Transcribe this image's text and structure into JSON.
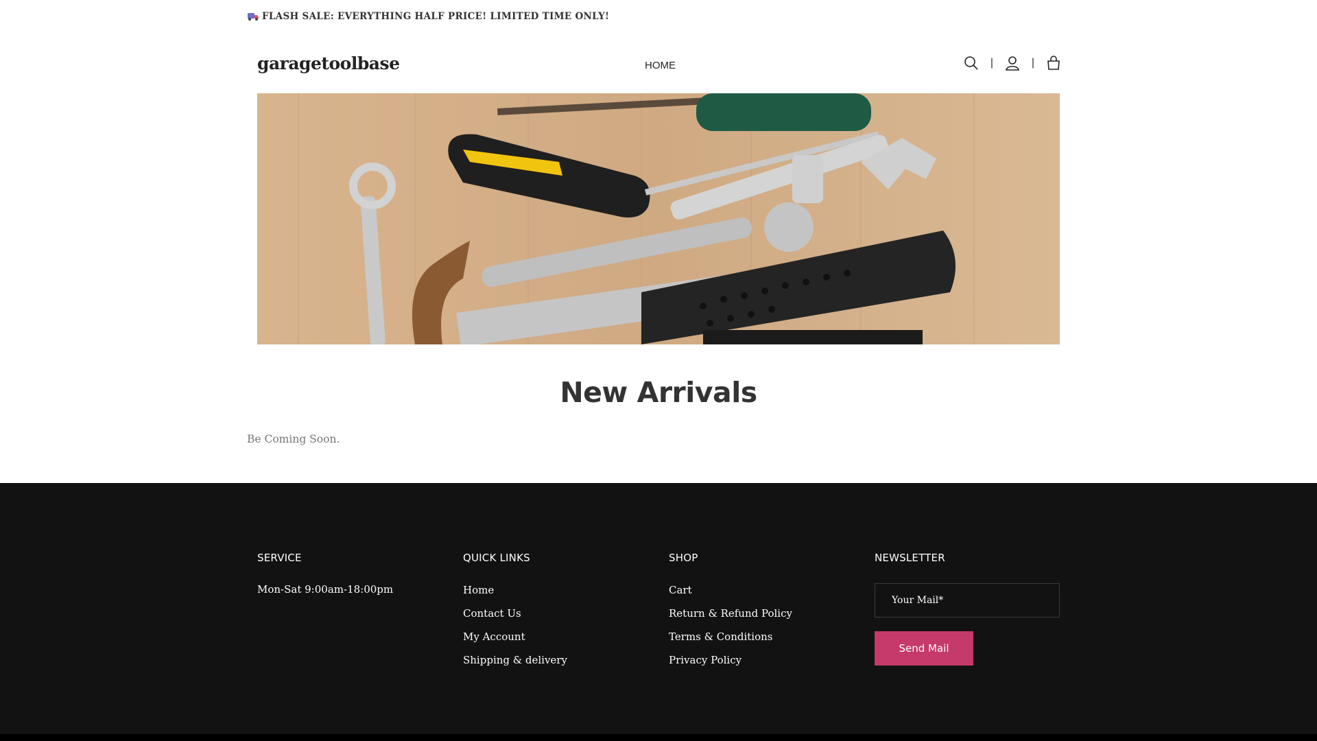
{
  "announcement": {
    "text": "FLASH SALE: EVERYTHING HALF PRICE! LIMITED TIME ONLY!",
    "icon": "truck-icon"
  },
  "header": {
    "logo": "garagetoolbase",
    "nav": [
      "HOME"
    ],
    "icons": [
      "search-icon",
      "user-icon",
      "cart-icon"
    ],
    "separator": "|"
  },
  "main": {
    "title": "New Arrivals",
    "message": "Be Coming Soon."
  },
  "footer": {
    "service": {
      "heading": "SERVICE",
      "hours": "Mon-Sat 9:00am-18:00pm"
    },
    "quick_links": {
      "heading": "QUICK LINKS",
      "items": [
        "Home",
        "Contact Us",
        "My Account",
        "Shipping & delivery"
      ]
    },
    "shop": {
      "heading": "SHOP",
      "items": [
        "Cart",
        "Return & Refund Policy",
        "Terms & Conditions",
        "Privacy Policy"
      ]
    },
    "newsletter": {
      "heading": "NEWSLETTER",
      "placeholder": "Your Mail*",
      "button": "Send Mail"
    }
  },
  "colors": {
    "accent": "#c53a6a",
    "footer_bg": "#121212",
    "text": "#333333"
  }
}
